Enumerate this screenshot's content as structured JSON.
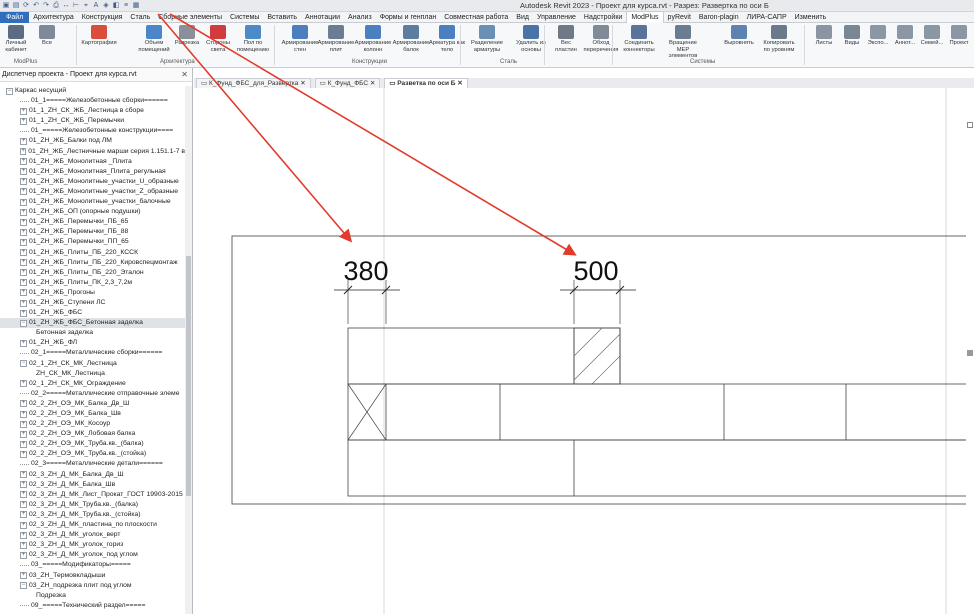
{
  "window": {
    "title": "Autodesk Revit 2023 - Проект для курса.rvt - Разрез: Развертка по оси Б"
  },
  "menu": {
    "items": [
      "Файл",
      "Архитектура",
      "Конструкция",
      "Сталь",
      "Сборные элементы",
      "Системы",
      "Вставить",
      "Аннотации",
      "Анализ",
      "Формы и генплан",
      "Совместная работа",
      "Вид",
      "Управление",
      "Надстройки",
      "ModPlus",
      "pyRevit",
      "Baron-plagin",
      "ЛИРА-САПР",
      "Изменить"
    ]
  },
  "ribbon": {
    "buttons": [
      "Личный кабинет",
      "Все",
      "Картография",
      "Объем помещений",
      "Разрезка",
      "Стороны света",
      "Пол по помещению",
      "Армирование стен",
      "Армирование плит",
      "Армирование колонн",
      "Армирование балок",
      "Арматура как тело",
      "Разделение арматуры",
      "Удалить из основы",
      "Вес пластин",
      "Обход переречения",
      "Соединить коннекторы",
      "Вращение МЕР элементов",
      "Выровнять",
      "Копировать по уровням",
      "Листы",
      "Виды",
      "Экспо...",
      "Аннот...",
      "Семей...",
      "Проект"
    ],
    "groups": [
      "ModPlus",
      "Архитектура",
      "Конструкции",
      "Сталь",
      "Системы"
    ]
  },
  "project_browser": {
    "title": "Диспетчер проекта - Проект для курса.rvt",
    "root": "Каркас несущий",
    "items": [
      "01_1=====Железобетонные сборки======",
      "01_1_ZH_СК_ЖБ_Лестница в сборе",
      "01_1_ZH_СК_ЖБ_Перемычки",
      "01_=====Железобетонные конструкции====",
      "01_ZH_ЖБ_Балки под ЛМ",
      "01_ZH_ЖБ_Лестничные марши серия 1.151.1-7 в",
      "01_ZH_ЖБ_Монолитная _Плита",
      "01_ZH_ЖБ_Монолитная_Плита_регульная",
      "01_ZH_ЖБ_Монолитные_участки_U_образные",
      "01_ZH_ЖБ_Монолитные_участки_Z_образные",
      "01_ZH_ЖБ_Монолитные_участки_балочные",
      "01_ZH_ЖБ_ОП (опорные подушки)",
      "01_ZH_ЖБ_Перемычки_ПБ_65",
      "01_ZH_ЖБ_Перемычки_ПБ_88",
      "01_ZH_ЖБ_Перемычки_ПП_65",
      "01_ZH_ЖБ_Плиты_ПБ_220_КССК",
      "01_ZH_ЖБ_Плиты_ПБ_220_Кировспецмонтаж",
      "01_ZH_ЖБ_Плиты_ПБ_220_Эталон",
      "01_ZH_ЖБ_Плиты_ПК_2,3_7,2м",
      "01_ZH_ЖБ_Прогоны",
      "01_ZH_ЖБ_Ступени ЛС",
      "01_ZH_ЖБ_ФБС",
      "01_ZH_ЖБ_ФБС_Бетонная заделка",
      "Бетонная заделка",
      "01_ZH_ЖБ_ФЛ",
      "02_1=====Металлические сборки======",
      "02_1_ZH_СК_МК_Лестница",
      "ZH_СК_МК_Лестница",
      "02_1_ZH_СК_МК_Ограждение",
      "02_2=====Металлические отправочные элеме",
      "02_2_ZH_ОЭ_МК_Балка_Дв_Ш",
      "02_2_ZH_ОЭ_МК_Балка_Шв",
      "02_2_ZH_ОЭ_МК_Косоур",
      "02_2_ZH_ОЭ_МК_Лобовая балка",
      "02_2_ZH_ОЭ_МК_Труба.кв._(балка)",
      "02_2_ZH_ОЭ_МК_Труба.кв._(стойка)",
      "02_3=====Металлические детали======",
      "02_3_ZH_Д_МК_Балка_Дв_Ш",
      "02_3_ZH_Д_МК_Балка_Шв",
      "02_3_ZH_Д_МК_Лист_Прокат_ГОСТ 19903-2015",
      "02_3_ZH_Д_МК_Труба.кв._(балка)",
      "02_3_ZH_Д_МК_Труба.кв._(стойка)",
      "02_3_ZH_Д_МК_пластина_по плоскости",
      "02_3_ZH_Д_МК_уголок_верт",
      "02_3_ZH_Д_МК_уголок_гориз",
      "02_3_ZH_Д_МК_уголок_под углом",
      "03_=====Модификаторы=====",
      "03_ZH_Термовкладыши",
      "03_ZH_подрезка плит под углом",
      "Подрезка",
      "09_=====Технический раздел====="
    ]
  },
  "tabs": [
    "К_Фунд_ФБС_для_Развертка",
    "К_Фунд_ФБС",
    "Разветка по оси Б"
  ],
  "drawing": {
    "dim1": "380",
    "dim2": "500"
  }
}
